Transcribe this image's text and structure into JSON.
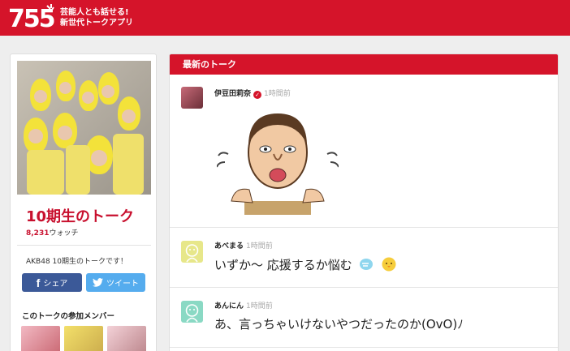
{
  "header": {
    "logo_text": "755",
    "tagline_line1": "芸能人とも話せる!",
    "tagline_line2": "新世代トークアプリ",
    "brand_color": "#d5142a"
  },
  "sidebar": {
    "talk_title": "10期生のトーク",
    "watch_count": "8,231",
    "watch_label": "ウォッチ",
    "description": "AKB48 10期生のトークです！",
    "share_facebook_label": "シェア",
    "share_twitter_label": "ツイート",
    "members_heading": "このトークの参加メンバー"
  },
  "feed": {
    "title": "最新のトーク",
    "posts": [
      {
        "author": "伊豆田莉奈",
        "verified": true,
        "time": "1時間前",
        "type": "sticker",
        "sticker_icon": "caricature-face-sticker"
      },
      {
        "author": "あべまる",
        "verified": false,
        "time": "1時間前",
        "type": "text",
        "text": "いずか〜 応援するか悩む",
        "emoji_icons": [
          "puff-icon",
          "chick-face-icon"
        ]
      },
      {
        "author": "あんにん",
        "verified": false,
        "time": "1時間前",
        "type": "text",
        "text": "あ、言っちゃいけないやつだったのか(OvO)ﾉ"
      }
    ]
  }
}
